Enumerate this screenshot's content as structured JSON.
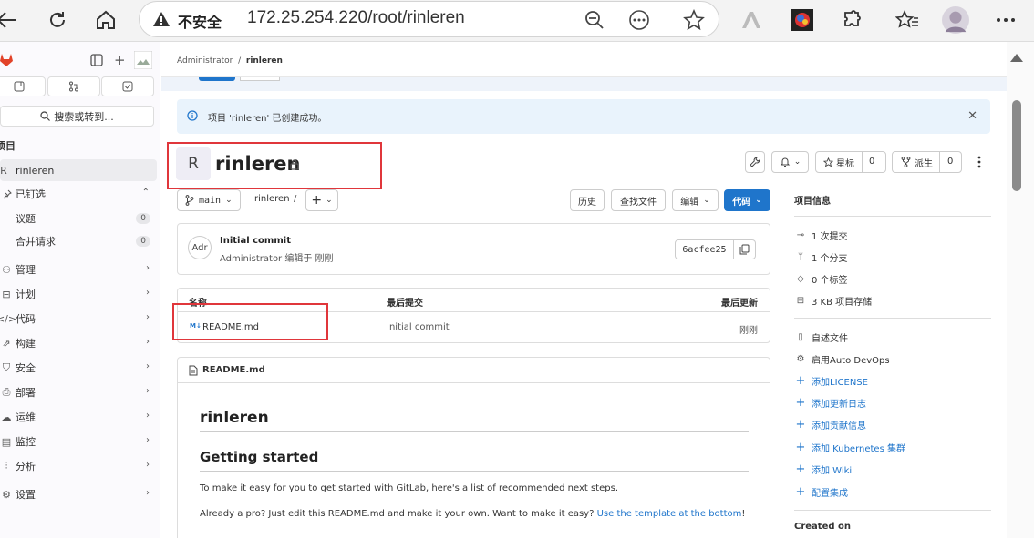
{
  "browser": {
    "security_label": "不安全",
    "url": "172.25.254.220/root/rinleren"
  },
  "sidebar": {
    "search_label": "搜索或转到...",
    "section_label": "项目",
    "project_item": {
      "avatar_letter": "R",
      "label": "rinleren"
    },
    "pinned_label": "已钉选",
    "pinned_items": [
      {
        "label": "议题",
        "count": "0"
      },
      {
        "label": "合并请求",
        "count": "0"
      }
    ],
    "nav_items": [
      {
        "label": "管理"
      },
      {
        "label": "计划"
      },
      {
        "label": "代码"
      },
      {
        "label": "构建"
      },
      {
        "label": "安全"
      },
      {
        "label": "部署"
      },
      {
        "label": "运维"
      },
      {
        "label": "监控"
      },
      {
        "label": "分析"
      },
      {
        "label": "设置"
      }
    ]
  },
  "breadcrumb": {
    "root": "Administrator",
    "separator": "/",
    "current": "rinleren"
  },
  "alert": {
    "message": "项目 'rinleren' 已创建成功。"
  },
  "project": {
    "avatar_letter": "R",
    "name": "rinleren",
    "star_label": "星标",
    "star_count": "0",
    "fork_label": "派生",
    "fork_count": "0"
  },
  "repo_toolbar": {
    "branch": "main",
    "path": "rinleren",
    "path_sep": "/",
    "history_label": "历史",
    "find_file_label": "查找文件",
    "edit_label": "编辑",
    "code_label": "代码"
  },
  "last_commit": {
    "avatar_text": "Adr",
    "title": "Initial commit",
    "author": "Administrator",
    "meta": "编辑于 刚刚",
    "sha": "6acfee25"
  },
  "file_table": {
    "headers": [
      "名称",
      "最后提交",
      "最后更新"
    ],
    "rows": [
      {
        "name": "README.md",
        "icon_text": "M↓",
        "commit": "Initial commit",
        "updated": "刚刚"
      }
    ]
  },
  "readme": {
    "filename": "README.md",
    "h1": "rinleren",
    "h2": "Getting started",
    "p1": "To make it easy for you to get started with GitLab, here's a list of recommended next steps.",
    "p2_text": "Already a pro? Just edit this README.md and make it your own. Want to make it easy?",
    "p2_link": "Use the template at the bottom",
    "p2_end": "!"
  },
  "project_info": {
    "title": "项目信息",
    "stats": [
      {
        "icon": "commit-icon",
        "label": "1 次提交"
      },
      {
        "icon": "branch-icon",
        "label": "1 个分支"
      },
      {
        "icon": "tag-icon",
        "label": "0 个标签"
      },
      {
        "icon": "storage-icon",
        "label": "3 KB 项目存储"
      }
    ],
    "actions": [
      {
        "icon": "file-icon",
        "label": "自述文件",
        "link": false
      },
      {
        "icon": "gear-icon",
        "label": "启用Auto DevOps",
        "link": false
      },
      {
        "icon": "plus-icon",
        "label": "添加LICENSE",
        "link": true
      },
      {
        "icon": "plus-icon",
        "label": "添加更新日志",
        "link": true
      },
      {
        "icon": "plus-icon",
        "label": "添加贡献信息",
        "link": true
      },
      {
        "icon": "plus-icon",
        "label": "添加 Kubernetes 集群",
        "link": true
      },
      {
        "icon": "plus-icon",
        "label": "添加 Wiki",
        "link": true
      },
      {
        "icon": "plus-icon",
        "label": "配置集成",
        "link": true
      }
    ],
    "created_on_label": "Created on"
  },
  "colors": {
    "primary": "#1f75cb",
    "highlight_box": "#e0363b",
    "alert_bg": "#e9f3fc"
  }
}
